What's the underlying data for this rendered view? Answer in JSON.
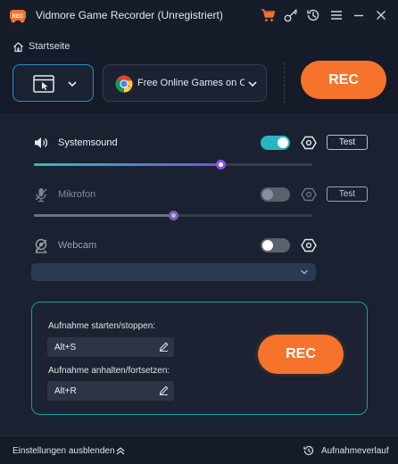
{
  "app": {
    "title": "Vidmore Game Recorder (Unregistriert)",
    "logo_badge": "REC"
  },
  "titlebar_icons": [
    "cart-icon",
    "key-icon",
    "history-icon",
    "menu-icon",
    "minimize-icon",
    "close-icon"
  ],
  "breadcrumb": {
    "label": "Startseite"
  },
  "area_selector": {
    "icon": "window-cursor-icon"
  },
  "source": {
    "label": "Free Online Games on Cr...",
    "icon": "chrome-icon"
  },
  "rec_top": {
    "label": "REC"
  },
  "audio": {
    "system": {
      "label": "Systemsound",
      "enabled": true,
      "volume_percent": 67,
      "test_label": "Test"
    },
    "mic": {
      "label": "Mikrofon",
      "enabled": false,
      "volume_percent": 50,
      "test_label": "Test"
    },
    "webcam": {
      "label": "Webcam",
      "enabled": false,
      "selected": ""
    }
  },
  "hotkeys": {
    "start_stop_label": "Aufnahme starten/stoppen:",
    "start_stop_value": "Alt+S",
    "pause_label": "Aufnahme anhalten/fortsetzen:",
    "pause_value": "Alt+R",
    "rec_label": "REC"
  },
  "footer": {
    "hide_settings_label": "Einstellungen ausblenden",
    "history_label": "Aufnahmeverlauf"
  },
  "colors": {
    "accent_orange": "#f6732c",
    "toggle_on": "#27b5c2",
    "toggle_off": "#5a606c",
    "border_blue": "#2c8cc9",
    "border_teal": "#1f9aa0",
    "background": "#151b28"
  }
}
